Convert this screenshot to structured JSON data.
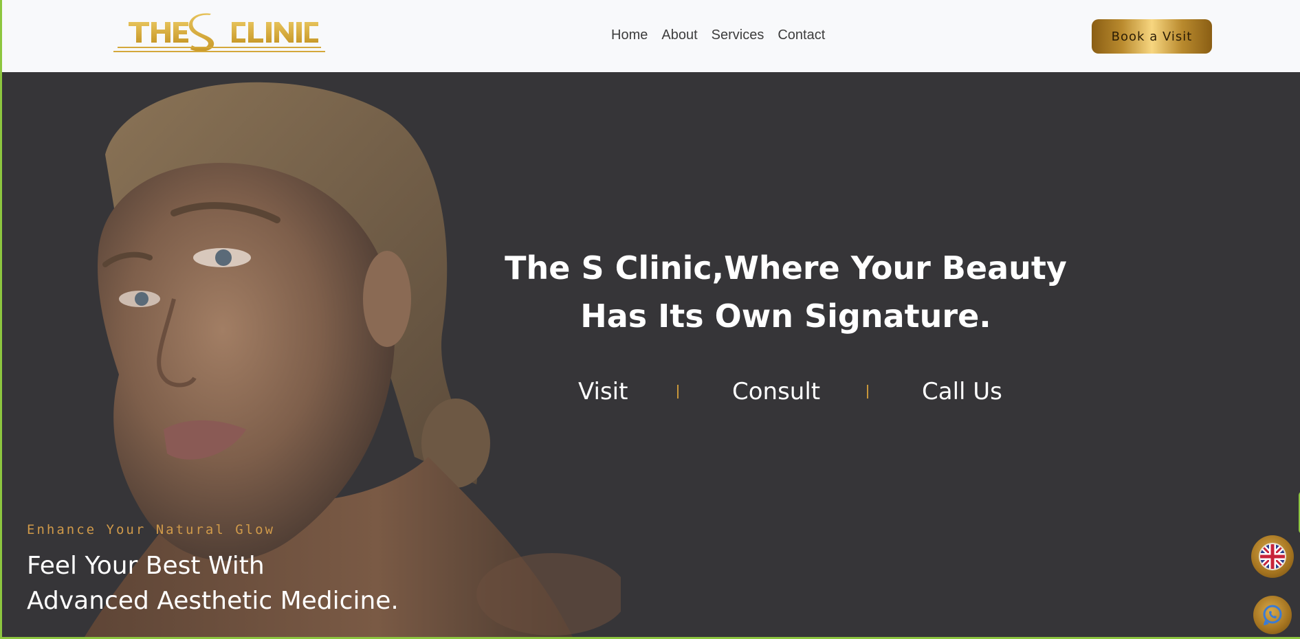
{
  "header": {
    "logo_text": "THE S CLINIC",
    "nav": [
      "Home",
      "About",
      "Services",
      "Contact"
    ],
    "cta_label": "Book a Visit"
  },
  "hero": {
    "title_line1": "The S Clinic,Where Your Beauty",
    "title_line2": "Has Its Own Signature.",
    "links": [
      "Visit",
      "Consult",
      "Call Us"
    ],
    "tagline": "Enhance Your Natural Glow",
    "subhead_line1": "Feel Your Best With",
    "subhead_line2": "Advanced Aesthetic Medicine."
  },
  "floating": {
    "language_icon": "uk-flag-icon",
    "whatsapp_icon": "whatsapp-icon"
  },
  "colors": {
    "accent_gold": "#c8963a",
    "hero_background": "#363538",
    "header_background": "#f8f9fb",
    "frame_green": "#8dc63f"
  }
}
